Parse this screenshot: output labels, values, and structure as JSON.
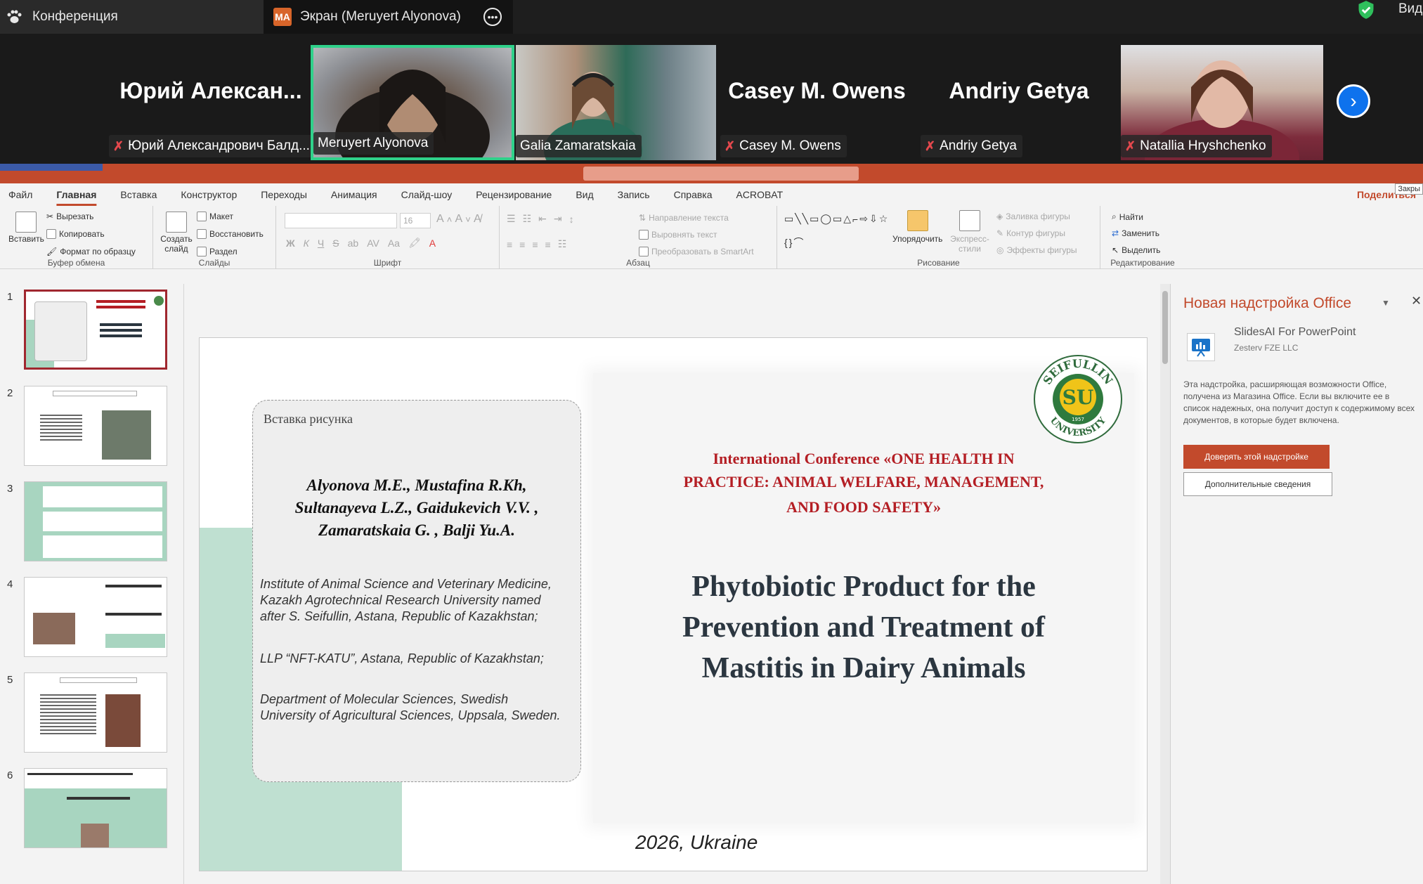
{
  "zoom": {
    "meeting_tab": "Конференция",
    "screen_badge": "MA",
    "screen_tab": "Экран (Meruyert Alyonova)",
    "view_label": "Вид",
    "participants": [
      {
        "name": "Юрий Александрович Балд...",
        "display": "Юрий  Алексан...",
        "muted": true,
        "video": false
      },
      {
        "name": "Meruyert Alyonova",
        "muted": false,
        "video": true,
        "active_speaker": true
      },
      {
        "name": "Galia Zamaratskaia",
        "muted": false,
        "video": true
      },
      {
        "name": "Casey M. Owens",
        "display": "Casey M. Owens",
        "muted": true,
        "video": false
      },
      {
        "name": "Andriy Getya",
        "display": "Andriy Getya",
        "muted": true,
        "video": false
      },
      {
        "name": "Natallia Hryshchenko",
        "muted": true,
        "video": true
      }
    ],
    "colors": {
      "active_border": "#2fd18a",
      "muted_icon": "#e5484d",
      "next_button": "#0e72ed"
    }
  },
  "ppt": {
    "menu": [
      "Файл",
      "Главная",
      "Вставка",
      "Конструктор",
      "Переходы",
      "Анимация",
      "Слайд-шоу",
      "Рецензирование",
      "Вид",
      "Запись",
      "Справка",
      "ACROBAT"
    ],
    "active_menu": "Главная",
    "share": "Поделиться",
    "close_tip": "Закры",
    "ribbon": {
      "clipboard": {
        "paste": "Вставить",
        "cut": "Вырезать",
        "copy": "Копировать",
        "format": "Формат по образцу",
        "label": "Буфер обмена"
      },
      "slides": {
        "create": "Создать слайд",
        "layout": "Макет",
        "reset": "Восстановить",
        "section": "Раздел",
        "label": "Слайды"
      },
      "font": {
        "size": "16",
        "label": "Шрифт"
      },
      "paragraph": {
        "text_direction": "Направление текста",
        "align_text": "Выровнять текст",
        "smartart": "Преобразовать в SmartArt",
        "label": "Абзац"
      },
      "drawing": {
        "arrange": "Упорядочить",
        "quick_styles": "Экспресс-стили",
        "fill": "Заливка фигуры",
        "outline": "Контур фигуры",
        "effects": "Эффекты фигуры",
        "label": "Рисование"
      },
      "editing": {
        "find": "Найти",
        "replace": "Заменить",
        "select": "Выделить",
        "label": "Редактирование"
      }
    },
    "thumbnails": [
      "1",
      "2",
      "3",
      "4",
      "5",
      "6"
    ],
    "slide": {
      "placeholder": "Вставка рисунка",
      "authors": [
        "Alyonova M.E., Mustafina R.Kh,",
        "Sultanayeva L.Z., Gaidukevich V.V. ,",
        "Zamaratskaia G. , Balji Yu.A."
      ],
      "affiliations": [
        "Institute of Animal Science and Veterinary Medicine, Kazakh Agrotechnical Research University named after S. Seifullin, Astana, Republic of Kazakhstan;",
        "LLP “NFT-KATU”, Astana, Republic of Kazakhstan;",
        "Department of Molecular Sciences, Swedish University of Agricultural Sciences, Uppsala, Sweden."
      ],
      "conference": [
        "International Conference «ONE HEALTH IN",
        "PRACTICE: ANIMAL WELFARE, MANAGEMENT,",
        "AND FOOD SAFETY»"
      ],
      "title": [
        "Phytobiotic Product for the",
        "Prevention and Treatment of",
        "Mastitis in Dairy Animals"
      ],
      "footer": "2026, Ukraine",
      "logo_top": "SEIFULLIN",
      "logo_bottom": "UNIVERSITY",
      "logo_mark": "SU",
      "logo_year": "1957"
    },
    "addin": {
      "title": "Новая надстройка Office",
      "name": "SlidesAI For PowerPoint",
      "vendor": "Zesterv FZE LLC",
      "description": "Эта надстройка, расширяющая возможности Office, получена из Магазина Office. Если вы включите ее в список надежных, она получит доступ к содержимому всех документов, в которые будет включена.",
      "trust_button": "Доверять этой надстройке",
      "more_button": "Дополнительные сведения"
    },
    "colors": {
      "accent": "#c24a2c",
      "slide_green": "#bfe0d1",
      "conf_red": "#b41e24"
    }
  }
}
